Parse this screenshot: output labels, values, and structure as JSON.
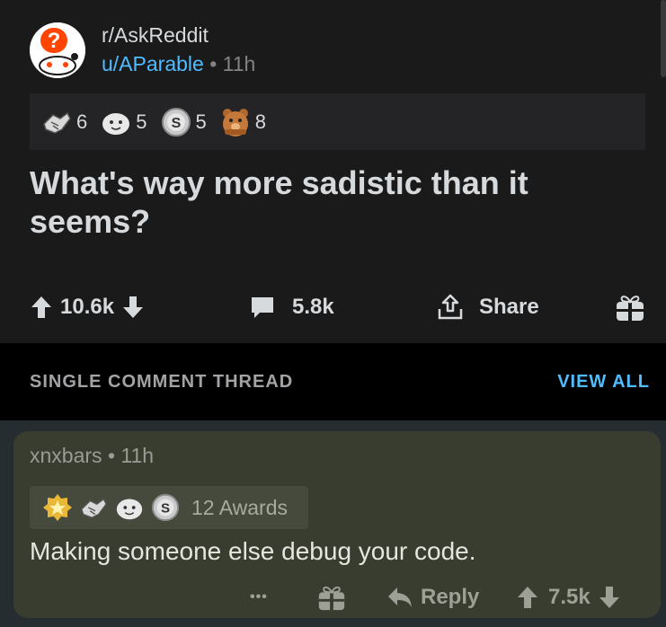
{
  "post": {
    "subreddit": "r/AskReddit",
    "author": "u/AParable",
    "separator": "•",
    "time": "11h",
    "awards": [
      {
        "icon": "helpful-handshake-icon",
        "count": "6"
      },
      {
        "icon": "wholesome-seal-icon",
        "count": "5"
      },
      {
        "icon": "silver-coin-icon",
        "count": "5"
      },
      {
        "icon": "bear-hug-icon",
        "count": "8"
      }
    ],
    "title": "What's way more sadistic than it seems?",
    "upvotes": "10.6k",
    "comments": "5.8k",
    "share_label": "Share"
  },
  "thread": {
    "label": "SINGLE COMMENT THREAD",
    "view_all": "VIEW ALL"
  },
  "comment": {
    "author": "xnxbars",
    "separator": "•",
    "time": "11h",
    "awards_label": "12 Awards",
    "award_icons": [
      "gold-star-icon",
      "helpful-handshake-icon",
      "wholesome-seal-icon",
      "silver-coin-icon"
    ],
    "text": "Making someone else debug your code.",
    "more": "•••",
    "reply_label": "Reply",
    "score": "7.5k"
  },
  "colors": {
    "background": "#1a1a1b",
    "link_blue": "#4fbcff",
    "comment_highlight": "#383d2f"
  }
}
